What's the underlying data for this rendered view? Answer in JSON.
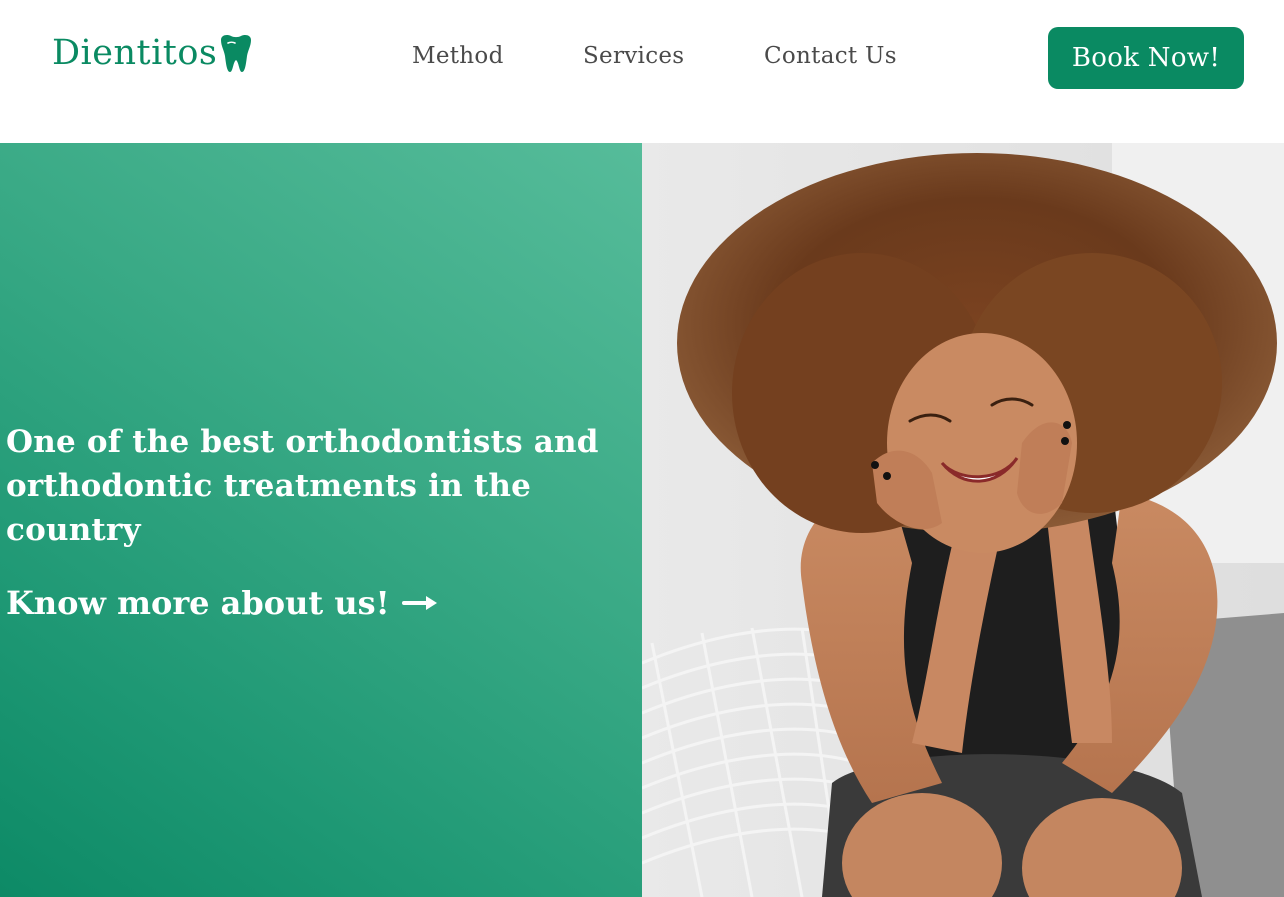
{
  "brand": {
    "name": "Dientitos",
    "accent_color": "#0a8a62",
    "logo_icon": "tooth-icon"
  },
  "nav": {
    "items": [
      {
        "label": "Method"
      },
      {
        "label": "Services"
      },
      {
        "label": "Contact Us"
      }
    ]
  },
  "header": {
    "cta_label": "Book Now!"
  },
  "hero": {
    "title": "One of the best orthodontists and orthodontic treatments in the country",
    "link_label": "Know more about us!",
    "link_icon": "arrow-right-icon",
    "gradient_colors": [
      "#56bc9a",
      "#0d8a66"
    ],
    "photo_subject_icon": "smiling-woman-photo"
  }
}
